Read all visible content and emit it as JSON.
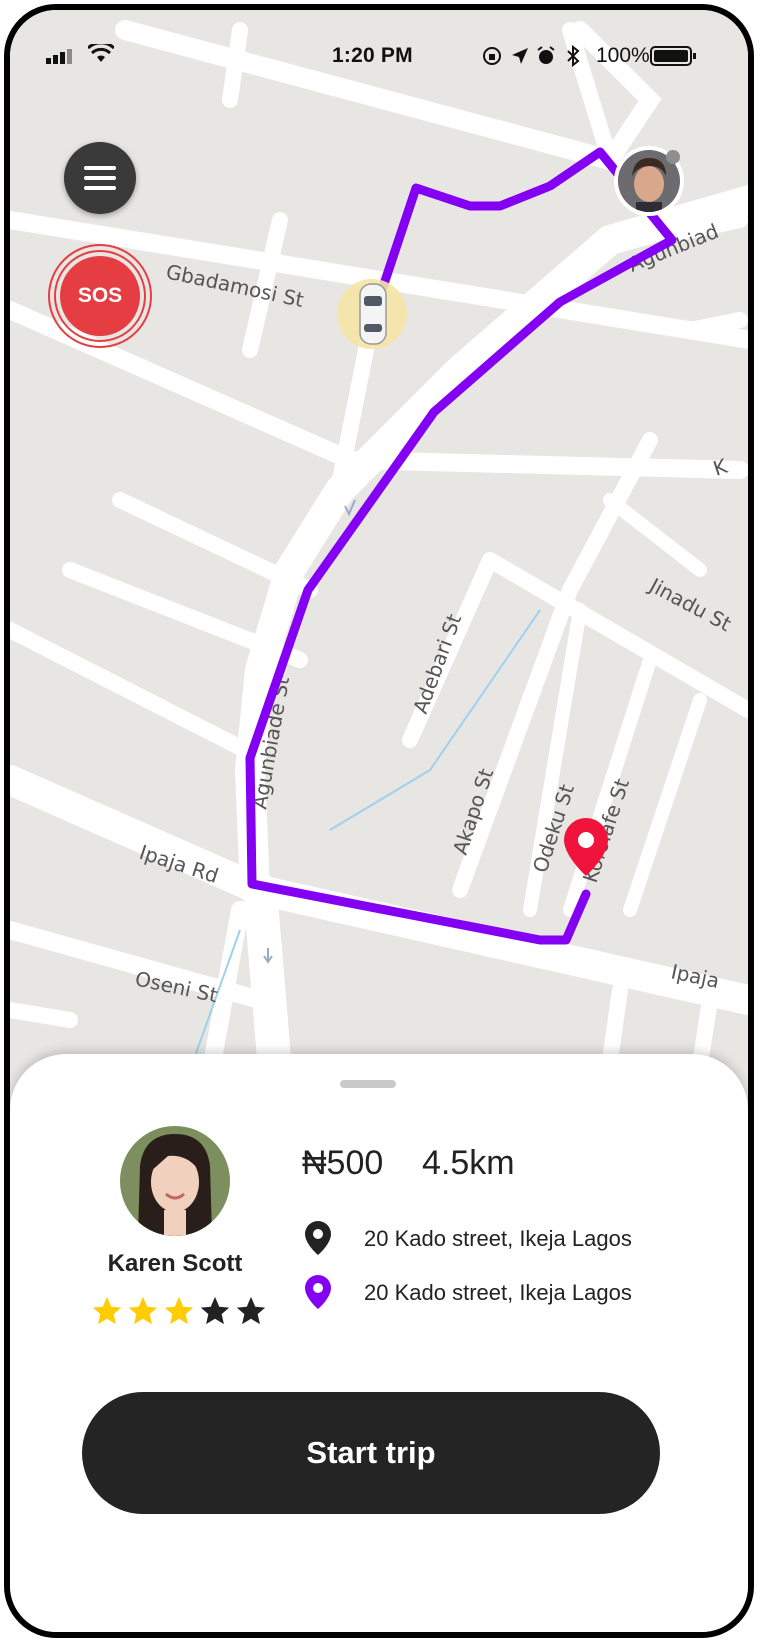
{
  "status_bar": {
    "time": "1:20 PM",
    "battery": "100%",
    "icons": [
      "signal-icon",
      "wifi-icon",
      "orientation-lock-icon",
      "location-arrow-icon",
      "alarm-icon",
      "bluetooth-icon",
      "battery-icon"
    ]
  },
  "map": {
    "streets": [
      "Gbadamosi St",
      "Agunbiade St",
      "Adebari St",
      "Akapo St",
      "Odeku St",
      "Kofolafe St",
      "Jinadu St",
      "Ipaja Rd",
      "Oseni St",
      "Ipaja",
      "Agunbiad",
      "K"
    ],
    "route_color": "#8300f2",
    "pin_color": "#f0143c"
  },
  "sos": {
    "label": "SOS",
    "color": "#e53d42"
  },
  "sheet": {
    "rider_name": "Karen Scott",
    "rating": 3,
    "rating_max": 5,
    "fare": "₦500",
    "distance": "4.5km",
    "pickup": "20 Kado street, Ikeja Lagos",
    "dropoff": "20 Kado street, Ikeja Lagos",
    "start_button": "Start trip"
  },
  "colors": {
    "accent": "#8300f2",
    "star": "#ffcc00",
    "star_empty": "#222222",
    "button": "#242424"
  }
}
